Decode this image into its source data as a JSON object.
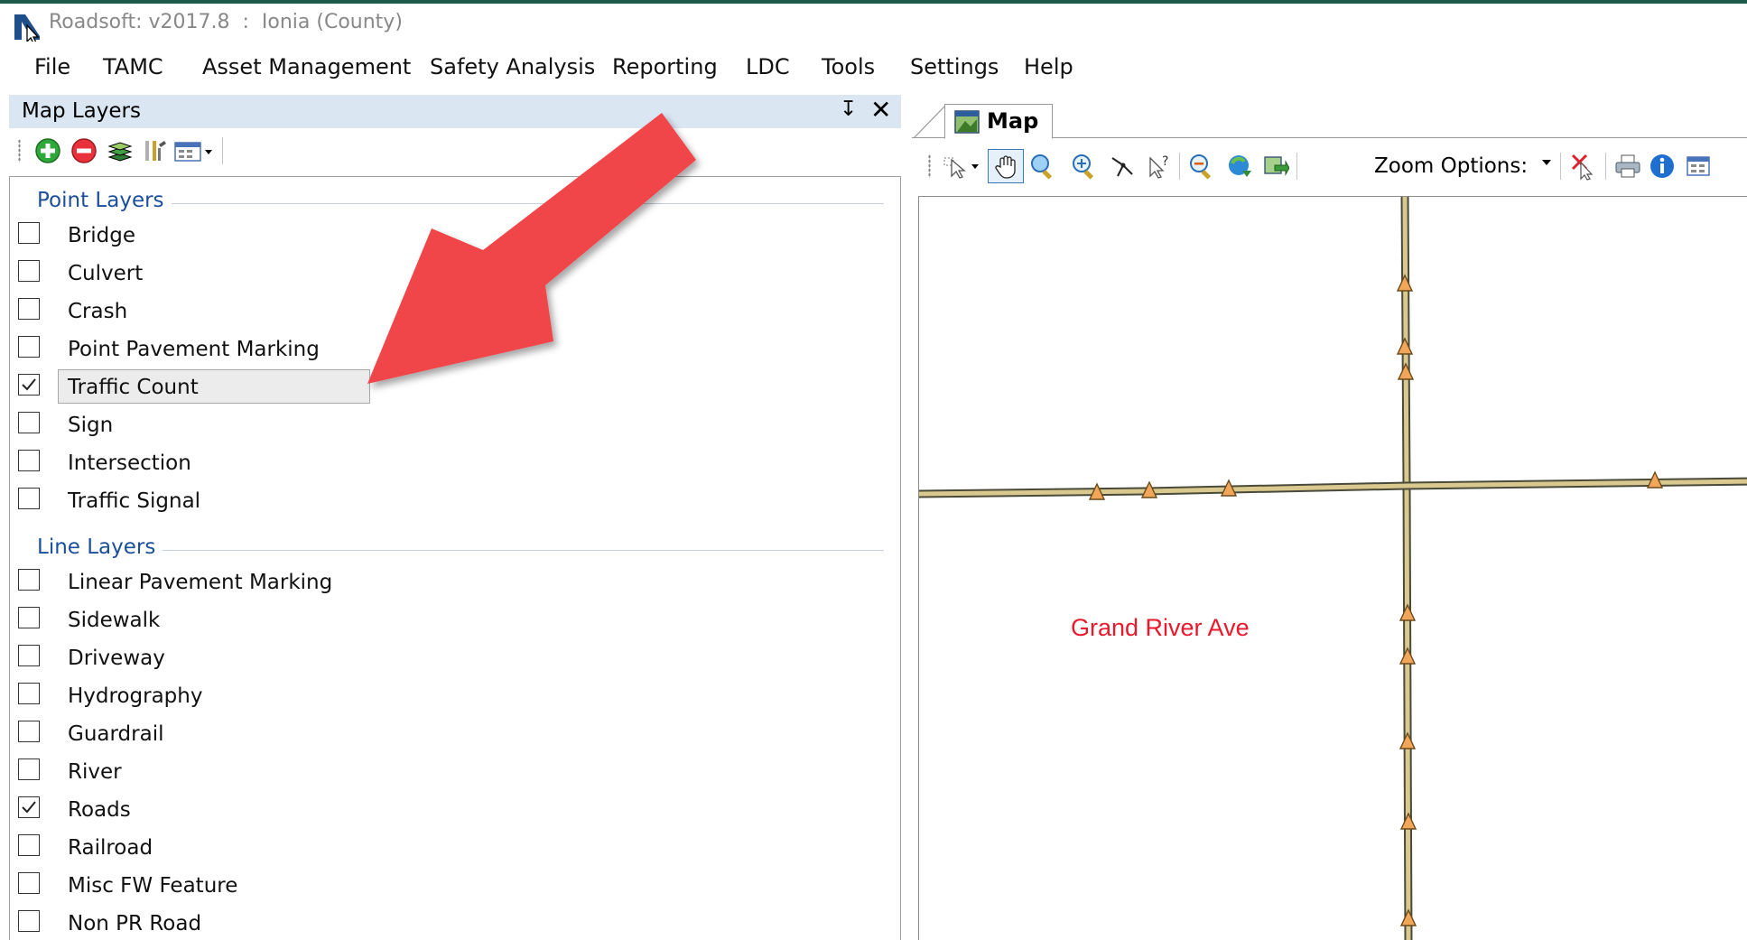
{
  "window": {
    "title": "Roadsoft: v2017.8  :  Ionia (County)"
  },
  "menu": {
    "items": [
      "File",
      "TAMC",
      "Asset Management",
      "Safety Analysis",
      "Reporting",
      "LDC",
      "Tools",
      "Settings",
      "Help"
    ]
  },
  "layers_panel": {
    "title": "Map Layers",
    "pin_glyph": "↧",
    "close_glyph": "✕",
    "toolbar_icons": [
      "add-layer-icon",
      "remove-layer-icon",
      "layers-stack-icon",
      "layer-properties-icon",
      "layer-view-dropdown-icon"
    ],
    "groups": [
      {
        "name": "Point Layers",
        "items": [
          {
            "label": "Bridge",
            "checked": false
          },
          {
            "label": "Culvert",
            "checked": false
          },
          {
            "label": "Crash",
            "checked": false
          },
          {
            "label": "Point Pavement Marking",
            "checked": false
          },
          {
            "label": "Traffic Count",
            "checked": true,
            "selected": true
          },
          {
            "label": "Sign",
            "checked": false
          },
          {
            "label": "Intersection",
            "checked": false
          },
          {
            "label": "Traffic Signal",
            "checked": false
          }
        ]
      },
      {
        "name": "Line Layers",
        "items": [
          {
            "label": "Linear Pavement Marking",
            "checked": false
          },
          {
            "label": "Sidewalk",
            "checked": false
          },
          {
            "label": "Driveway",
            "checked": false
          },
          {
            "label": "Hydrography",
            "checked": false
          },
          {
            "label": "Guardrail",
            "checked": false
          },
          {
            "label": "River",
            "checked": false
          },
          {
            "label": "Roads",
            "checked": true
          },
          {
            "label": "Railroad",
            "checked": false
          },
          {
            "label": "Misc FW Feature",
            "checked": false
          },
          {
            "label": "Non PR Road",
            "checked": false
          }
        ]
      }
    ]
  },
  "map": {
    "tab_label": "Map",
    "zoom_options_label": "Zoom Options:",
    "toolbar_icons": [
      "select-arrow-icon",
      "pan-hand-icon",
      "zoom-in-icon",
      "zoom-extents-icon",
      "measure-icon",
      "identify-icon",
      "zoom-out-icon",
      "refresh-map-icon",
      "export-map-icon",
      "clear-selection-icon",
      "print-icon",
      "info-icon",
      "table-icon"
    ],
    "road_label": "Grand River Ave",
    "road_color": "#d9c98e",
    "marker_color": "#f2a65a",
    "label_color": "#e8192c"
  },
  "annotation": {
    "arrow_color": "#f0454a",
    "points_to": "Traffic Count"
  }
}
